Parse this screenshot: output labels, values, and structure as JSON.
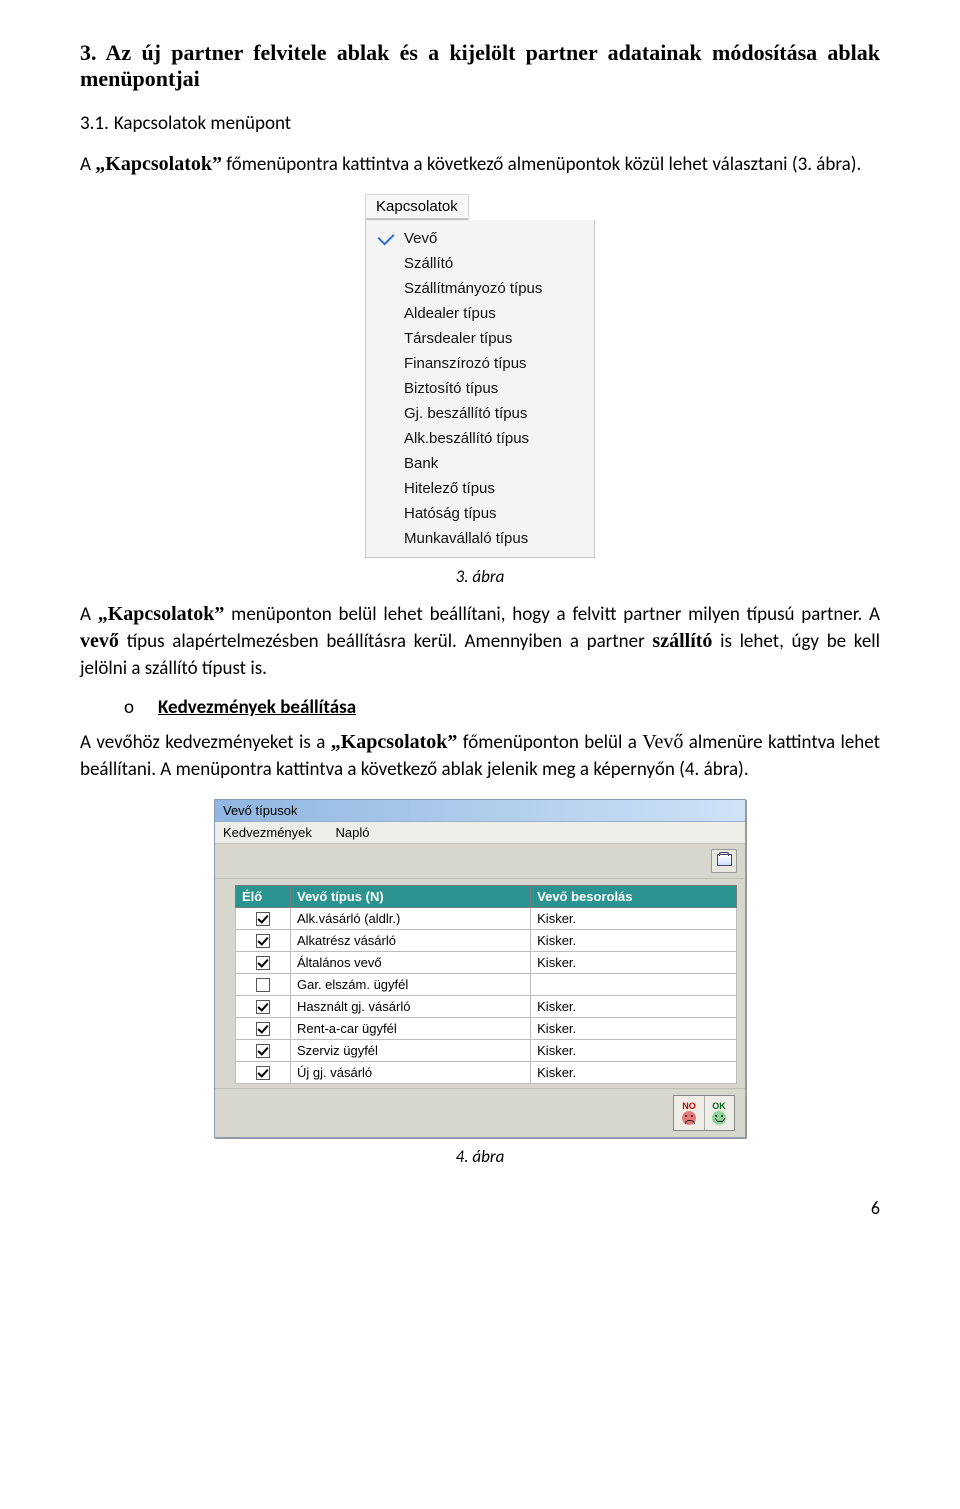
{
  "section": {
    "heading": "3. Az új partner felvitele ablak és a kijelölt partner adatainak módosítása ablak menüpontjai",
    "sub_number": "3.1.",
    "sub_title": "Kapcsolatok menüpont"
  },
  "para1": {
    "pre": "A ",
    "quoted": "„Kapcsolatok”",
    "post": " főmenüpontra kattintva a következő almenüpontok közül lehet választani (3. ábra)."
  },
  "dropdown": {
    "title": "Kapcsolatok",
    "items": [
      {
        "label": "Vevő",
        "checked": true
      },
      {
        "label": "Szállító",
        "checked": false
      },
      {
        "label": "Szállítmányozó típus",
        "checked": false
      },
      {
        "label": "Aldealer típus",
        "checked": false
      },
      {
        "label": "Társdealer típus",
        "checked": false
      },
      {
        "label": "Finanszírozó típus",
        "checked": false
      },
      {
        "label": "Biztosító típus",
        "checked": false
      },
      {
        "label": "Gj. beszállító típus",
        "checked": false
      },
      {
        "label": "Alk.beszállító típus",
        "checked": false
      },
      {
        "label": "Bank",
        "checked": false
      },
      {
        "label": "Hitelező típus",
        "checked": false
      },
      {
        "label": "Hatóság típus",
        "checked": false
      },
      {
        "label": "Munkavállaló típus",
        "checked": false
      }
    ]
  },
  "fig1_caption": "3. ábra",
  "para2": {
    "pre": "A ",
    "q1": "„Kapcsolatok”",
    "mid1": " menüponton belül lehet beállítani, hogy a felvitt partner milyen típusú partner. A ",
    "bold1": "vevő",
    "mid2": " típus alapértelmezésben beállításra kerül. Amennyiben a partner ",
    "bold2": "szállító",
    "mid3": " is lehet, úgy be kell jelölni a szállító típust is."
  },
  "bullet": {
    "circle": "o",
    "text": "Kedvezmények beállítása"
  },
  "para3": {
    "pre": "A vevőhöz kedvezményeket is a ",
    "q1": "„Kapcsolatok”",
    "mid1": " főmenüponton belül a ",
    "code": "Vevő",
    "mid2": " almenüre kattintva lehet beállítani. A menüpontra kattintva a következő ablak jelenik meg a képernyőn (4. ábra)."
  },
  "window": {
    "title": "Vevő típusok",
    "menu": {
      "item1": "Kedvezmények",
      "item2": "Napló"
    },
    "headers": {
      "c1": "Élő",
      "c2": "Vevő típus (N)",
      "c3": "Vevő besorolás"
    },
    "rows": [
      {
        "checked": true,
        "name": "Alk.vásárló (aldlr.)",
        "cls": "Kisker."
      },
      {
        "checked": true,
        "name": "Alkatrész vásárló",
        "cls": "Kisker."
      },
      {
        "checked": true,
        "name": "Általános vevő",
        "cls": "Kisker."
      },
      {
        "checked": false,
        "name": "Gar. elszám. ügyfél",
        "cls": ""
      },
      {
        "checked": true,
        "name": "Használt gj. vásárló",
        "cls": "Kisker."
      },
      {
        "checked": true,
        "name": "Rent-a-car ügyfél",
        "cls": "Kisker."
      },
      {
        "checked": true,
        "name": "Szerviz ügyfél",
        "cls": "Kisker."
      },
      {
        "checked": true,
        "name": "Új gj. vásárló",
        "cls": "Kisker."
      }
    ],
    "buttons": {
      "no": "NO",
      "ok": "OK"
    }
  },
  "fig2_caption": "4. ábra",
  "page_number": "6"
}
